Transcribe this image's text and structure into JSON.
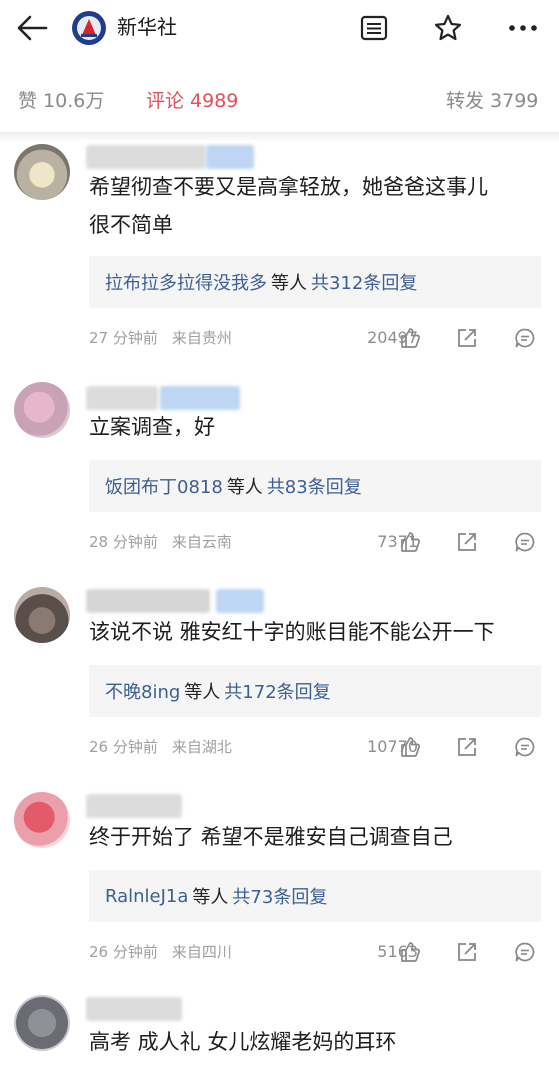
{
  "header": {
    "brand_name": "新华社"
  },
  "stats": {
    "likes": "赞 10.6万",
    "comments": "评论 4989",
    "reposts": "转发 3799"
  },
  "comments": [
    {
      "text_line1": "希望彻查不要又是高拿轻放，她爸爸这事儿",
      "text_line2": "很不简单",
      "reply_names": "拉布拉多拉得没我多",
      "reply_mid": "等人",
      "reply_count": "共312条回复",
      "time": "27 分钟前",
      "location": "来自贵州",
      "likes": "20497"
    },
    {
      "text_line1": "立案调查，好",
      "reply_names": "饭团布丁0818",
      "reply_mid": "等人",
      "reply_count": "共83条回复",
      "time": "28 分钟前",
      "location": "来自云南",
      "likes": "7371"
    },
    {
      "text_line1": "该说不说 雅安红十字的账目能不能公开一下",
      "reply_names": "不晚8ing",
      "reply_mid": "等人",
      "reply_count": "共172条回复",
      "time": "26 分钟前",
      "location": "来自湖北",
      "likes": "10770"
    },
    {
      "text_line1": "终于开始了 希望不是雅安自己调查自己",
      "reply_names": "RalnleJ1a",
      "reply_mid": "等人",
      "reply_count": "共73条回复",
      "time": "26 分钟前",
      "location": "来自四川",
      "likes": "5163"
    },
    {
      "text_line1": "高考 成人礼 女儿炫耀老妈的耳环"
    }
  ]
}
